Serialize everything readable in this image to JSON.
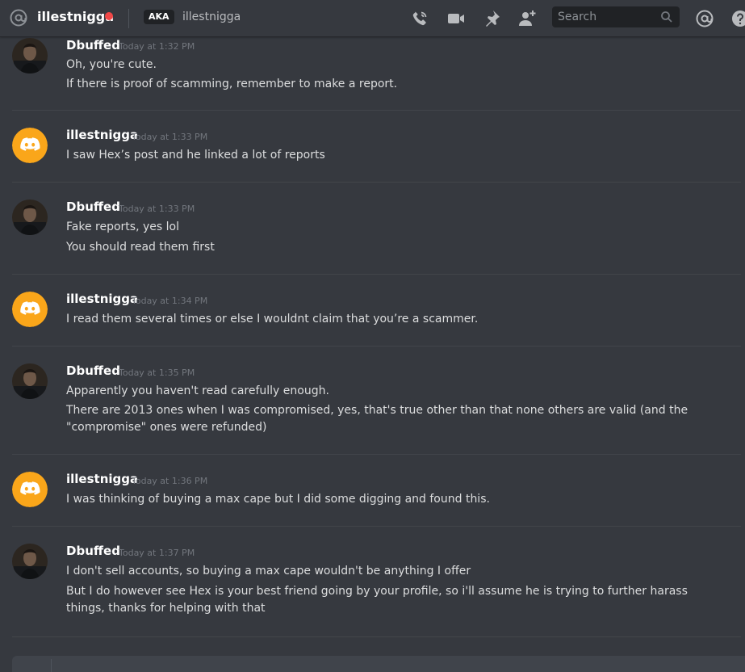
{
  "header": {
    "dm_name": "illestnigga",
    "aka_badge": "AKA",
    "aka_name": "illestnigga",
    "search_placeholder": "Search",
    "status_color": "#f04747"
  },
  "icons": {
    "at": "at-sign-icon",
    "call": "phone-call-icon",
    "video": "video-camera-icon",
    "pin": "pin-icon",
    "add_friend": "add-friend-icon",
    "search": "search-icon",
    "mentions": "mentions-icon",
    "help": "help-icon"
  },
  "colors": {
    "background": "#36393f",
    "discord_default_avatar": "#faa61a",
    "username": "#ffffff",
    "timestamp": "#72767d"
  },
  "messages": [
    {
      "author": "Dbuffed",
      "timestamp": "Today at 1:32 PM",
      "lines": [
        "Oh, you're cute.",
        "If there is proof of scamming, remember to make a report."
      ]
    },
    {
      "author": "illestnigga",
      "timestamp": "Today at 1:33 PM",
      "lines": [
        "I saw Hex’s post and he linked a lot of reports"
      ]
    },
    {
      "author": "Dbuffed",
      "timestamp": "Today at 1:33 PM",
      "lines": [
        "Fake reports, yes lol",
        "You should read them first"
      ]
    },
    {
      "author": "illestnigga",
      "timestamp": "Today at 1:34 PM",
      "lines": [
        "I read them several times or else I wouldnt claim that you’re a scammer."
      ]
    },
    {
      "author": "Dbuffed",
      "timestamp": "Today at 1:35 PM",
      "lines": [
        "Apparently you haven't read carefully enough.",
        "There are 2013 ones when I was compromised, yes, that's true other than that none others are valid (and the \"compromise\" ones were refunded)"
      ]
    },
    {
      "author": "illestnigga",
      "timestamp": "Today at 1:36 PM",
      "lines": [
        "I was thinking of buying a max cape but I did some digging and found this."
      ]
    },
    {
      "author": "Dbuffed",
      "timestamp": "Today at 1:37 PM",
      "lines": [
        "I don't sell accounts, so buying a max cape wouldn't be anything I offer",
        "But I do however see Hex is your best friend going by your profile, so i'll assume he is trying to further harass things, thanks for helping with that"
      ]
    }
  ]
}
